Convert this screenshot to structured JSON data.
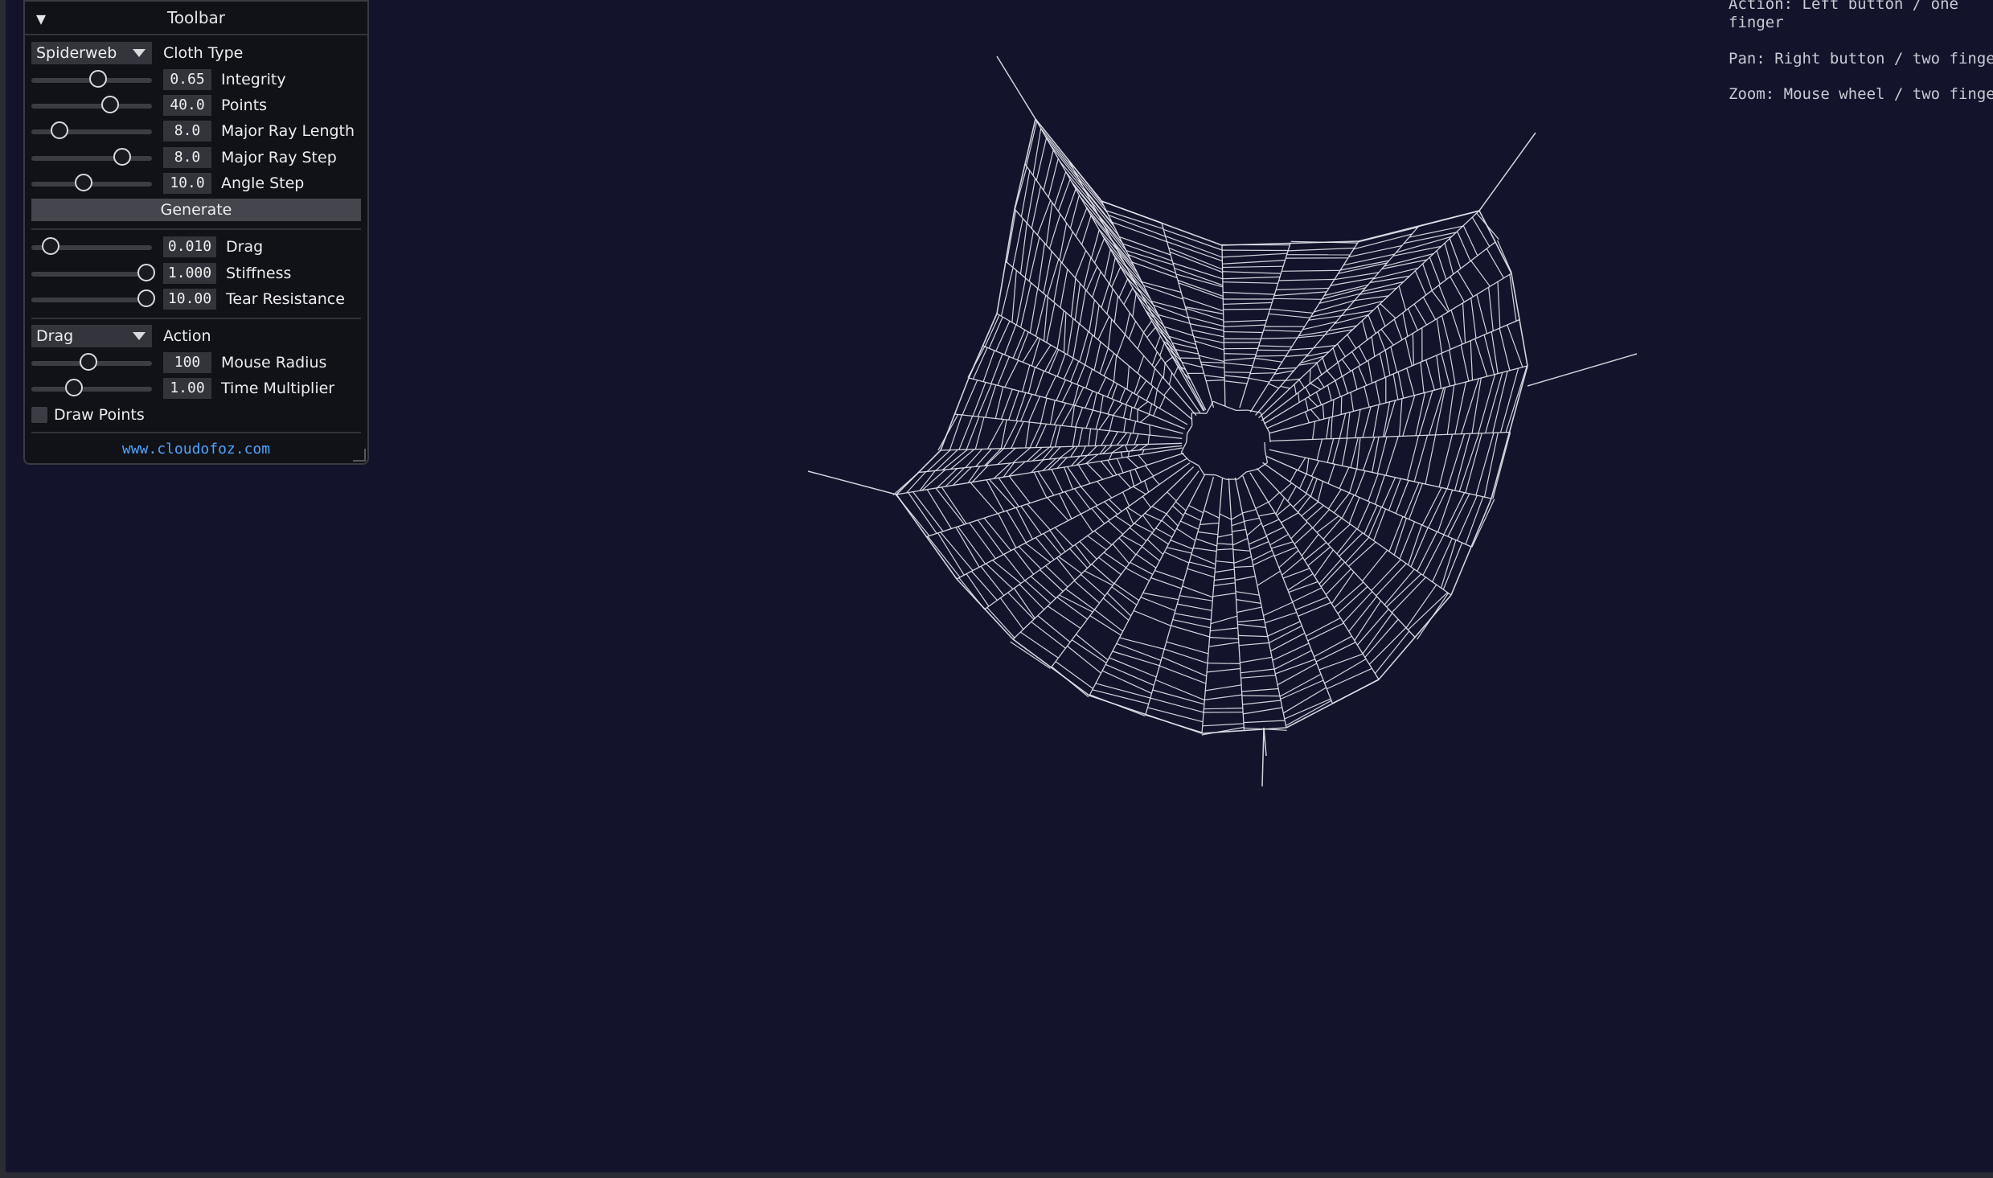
{
  "toolbar": {
    "title": "Toolbar",
    "collapse_icon": "triangle-down-icon",
    "cloth_type": {
      "value": "Spiderweb",
      "label": "Cloth Type"
    },
    "web_params": [
      {
        "label": "Integrity",
        "value": "0.65",
        "slider_fraction": 0.55
      },
      {
        "label": "Points",
        "value": "40.0",
        "slider_fraction": 0.65
      },
      {
        "label": "Major Ray Length",
        "value": "8.0",
        "slider_fraction": 0.23
      },
      {
        "label": "Major Ray Step",
        "value": "8.0",
        "slider_fraction": 0.75
      },
      {
        "label": "Angle Step",
        "value": "10.0",
        "slider_fraction": 0.43
      }
    ],
    "generate_label": "Generate",
    "physics_params": [
      {
        "label": "Drag",
        "value": "0.010",
        "slider_fraction": 0.16
      },
      {
        "label": "Stiffness",
        "value": "1.000",
        "slider_fraction": 0.95
      },
      {
        "label": "Tear Resistance",
        "value": "10.00",
        "slider_fraction": 0.95
      }
    ],
    "action": {
      "value": "Drag",
      "label": "Action"
    },
    "interaction_params": [
      {
        "label": "Mouse Radius",
        "value": "100",
        "slider_fraction": 0.47
      },
      {
        "label": "Time Multiplier",
        "value": "1.00",
        "slider_fraction": 0.35
      }
    ],
    "draw_points": {
      "label": "Draw Points",
      "checked": false
    },
    "link": "www.cloudofoz.com"
  },
  "help": {
    "action": "Action: Left button / one finger",
    "pan": "Pan: Right button / two finger",
    "zoom": "Zoom: Mouse wheel / two finger"
  },
  "colors": {
    "background": "#13142c",
    "web": "#e8e8f0",
    "panel": "#111217",
    "link": "#4ea3ff"
  }
}
